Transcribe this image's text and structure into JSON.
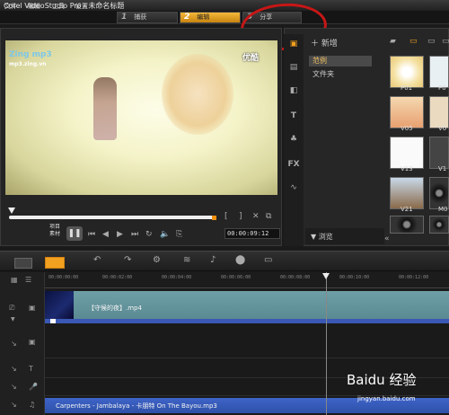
{
  "window": {
    "title": "Corel VideoStudio Pro - 未命名标题"
  },
  "menu": {
    "items": [
      "文件",
      "编辑",
      "工具",
      "设置"
    ]
  },
  "steps": [
    {
      "num": "1",
      "label": "捕获"
    },
    {
      "num": "2",
      "label": "编辑"
    },
    {
      "num": "3",
      "label": "分享"
    }
  ],
  "player": {
    "overlay_logo": "Zing mp3",
    "overlay_logo_sub": "mp3.zing.vn",
    "overlay_channel": "优酷",
    "mode_label": "项目\n素材",
    "timecode": "00:00:09:12",
    "progress": 0.0
  },
  "library": {
    "new_label": "新增",
    "folders": [
      "范例",
      "文件夹"
    ],
    "selected_folder": "范例",
    "browse_label": "浏览",
    "thumbs": [
      "P01",
      "P0",
      "V05",
      "V0",
      "V13",
      "V1",
      "V21",
      "M0"
    ]
  },
  "timeline": {
    "ruler": [
      "00:00:00:00",
      "00:00:02:00",
      "00:00:04:00",
      "00:00:06:00",
      "00:00:08:00",
      "00:00:10:00",
      "00:00:12:00"
    ],
    "video_clip": "【守候的夜】.mp4",
    "audio_clip": "Carpenters - Jambalaya - 卡朋特 On The Bayou.mp3"
  },
  "watermark": {
    "main": "Baidu 经验",
    "sub": "jingyan.baidu.com"
  },
  "colors": {
    "accent": "#f2a020",
    "audio": "#3a5cc0",
    "video": "#6a9aa2",
    "annotation": "#c81616"
  }
}
